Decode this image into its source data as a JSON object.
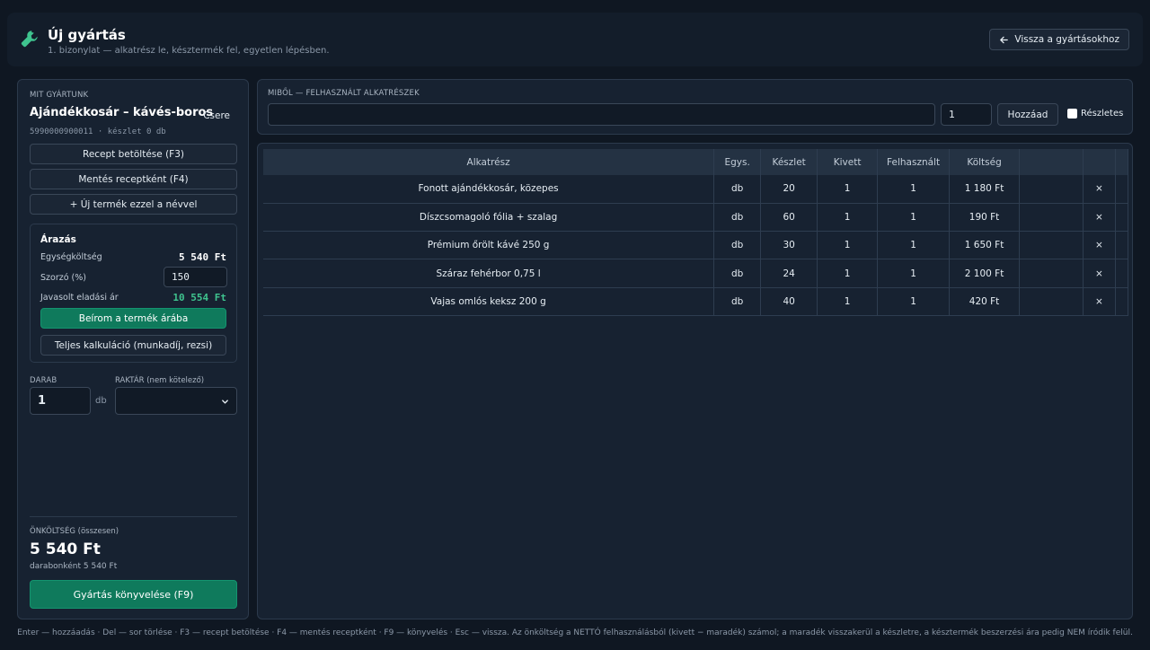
{
  "header": {
    "title": "Új gyártás",
    "subtitle": "1. bizonylat — alkatrész le, késztermék fel, egyetlen lépésben.",
    "back_label": "Vissza a gyártásokhoz"
  },
  "left": {
    "section_label": "MIT GYÁRTUNK",
    "product_name": "Ajándékkosár – kávés-boros",
    "swap_label": "Csere",
    "product_meta": "5990000900011 · készlet 0 db",
    "load_recipe": "Recept betöltése (F3)",
    "save_recipe": "Mentés receptként (F4)",
    "new_product": "+ Új termék ezzel a névvel",
    "pricing": {
      "title": "Árazás",
      "unit_cost_label": "Egységköltség",
      "unit_cost_value": "5 540 Ft",
      "multiplier_label": "Szorzó (%)",
      "multiplier_value": "150",
      "suggested_label": "Javasolt eladási ár",
      "suggested_value": "10 554 Ft",
      "apply_label": "Beírom a termék árába",
      "full_calc_label": "Teljes kalkuláció (munkadíj, rezsi)"
    },
    "qty_label": "DARAB",
    "qty_value": "1",
    "qty_unit": "db",
    "warehouse_label": "RAKTÁR (nem kötelező)",
    "warehouse_value": "",
    "cost_label": "ÖNKÖLTSÉG (összesen)",
    "cost_total": "5 540 Ft",
    "cost_per_unit": "darabonként 5 540 Ft",
    "post_label": "Gyártás könyvelése (F9)"
  },
  "parts": {
    "section_label": "MIBŐL — FELHASZNÁLT ALKATRÉSZEK",
    "search_value": "",
    "qty_value": "1",
    "add_label": "Hozzáad",
    "detailed_label": "Részletes"
  },
  "table": {
    "headers": [
      "Alkatrész",
      "Egys.",
      "Készlet",
      "Kivett",
      "Felhasznált",
      "Költség"
    ],
    "rows": [
      {
        "name": "Fonott ajándékkosár, közepes",
        "unit": "db",
        "stock": "20",
        "taken": "1",
        "used": "1",
        "cost": "1 180 Ft"
      },
      {
        "name": "Díszcsomagoló fólia + szalag",
        "unit": "db",
        "stock": "60",
        "taken": "1",
        "used": "1",
        "cost": "190 Ft"
      },
      {
        "name": "Prémium őrölt kávé 250 g",
        "unit": "db",
        "stock": "30",
        "taken": "1",
        "used": "1",
        "cost": "1 650 Ft"
      },
      {
        "name": "Száraz fehérbor 0,75 l",
        "unit": "db",
        "stock": "24",
        "taken": "1",
        "used": "1",
        "cost": "2 100 Ft"
      },
      {
        "name": "Vajas omlós keksz 200 g",
        "unit": "db",
        "stock": "40",
        "taken": "1",
        "used": "1",
        "cost": "420 Ft"
      }
    ],
    "delete_glyph": "×"
  },
  "footer": "Enter — hozzáadás · Del — sor törlése · F3 — recept betöltése · F4 — mentés receptként · F9 — könyvelés · Esc — vissza. Az önköltség a NETTÓ felhasználásból (kivett − maradék) számol; a maradék visszakerül a készletre, a késztermék beszerzési ára pedig NEM íródik felül.",
  "colors": {
    "accent": "#0f7a5c",
    "positive": "#3fc48f"
  },
  "icons": {
    "header": "wrench-icon",
    "back": "arrow-left-icon",
    "select": "chevron-down-icon",
    "delete": "close-icon"
  }
}
